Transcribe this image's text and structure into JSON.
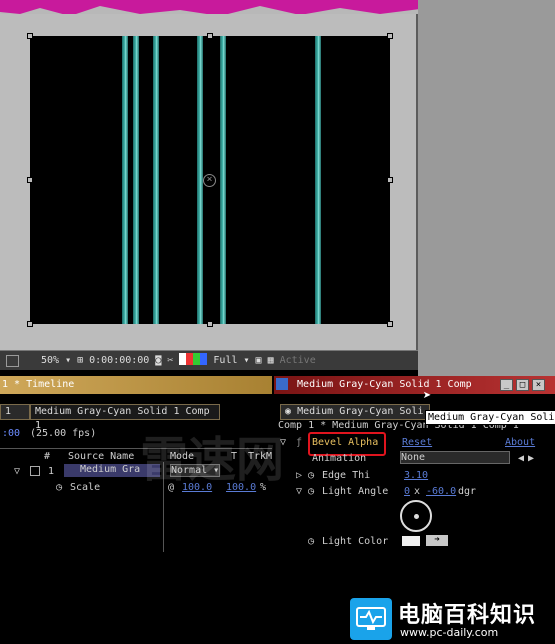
{
  "comp_toolbar": {
    "zoom": "50%",
    "timecode": "0:00:00:00",
    "resolution": "Full",
    "view_label": "Active"
  },
  "timeline": {
    "title": "1 * Timeline",
    "tab_label": "Medium Gray-Cyan Solid 1 Comp 1",
    "tab_num": "1",
    "time_prefix": ":00",
    "fps": "(25.00 fps)",
    "columns": {
      "hash": "#",
      "source": "Source Name",
      "mode": "Mode",
      "t": "T",
      "trkmat": "TrkM"
    },
    "layer": {
      "num": "1",
      "name": "Medium Gra",
      "mode": "Normal"
    },
    "scale": {
      "label": "Scale",
      "x": "100.0",
      "y": "100.0",
      "unit": "%"
    }
  },
  "effect_controls": {
    "title": "Medium Gray-Cyan Solid 1 Comp",
    "tab_label": "Medium Gray-Cyan Soli",
    "breadcrumb": "Comp 1 * Medium Gray-Cyan Solid 1 Comp 1",
    "effect_name": "Bevel Alpha",
    "reset": "Reset",
    "about": "About",
    "animation_label": "Animation",
    "animation_value": "None",
    "edge_label": "Edge Thi",
    "edge_value": "3.10",
    "light_angle_label": "Light Angle",
    "light_angle_rot": "0",
    "light_angle_x": "x",
    "light_angle_deg": "-60.0",
    "light_angle_unit": "dgr",
    "light_color_label": "Light Color"
  },
  "tooltip": "Medium Gray-Cyan Solid",
  "watermark": {
    "title": "电脑百科知识",
    "url": "www.pc-daily.com",
    "overlay_text": "雷速网"
  },
  "colors": {
    "accent_magenta": "#c81a9c",
    "bar_cyan": "#3fb3a9",
    "title_gold": "#cfa85a",
    "highlight_red": "#e0141e",
    "value_blue": "#5a7bd5"
  }
}
